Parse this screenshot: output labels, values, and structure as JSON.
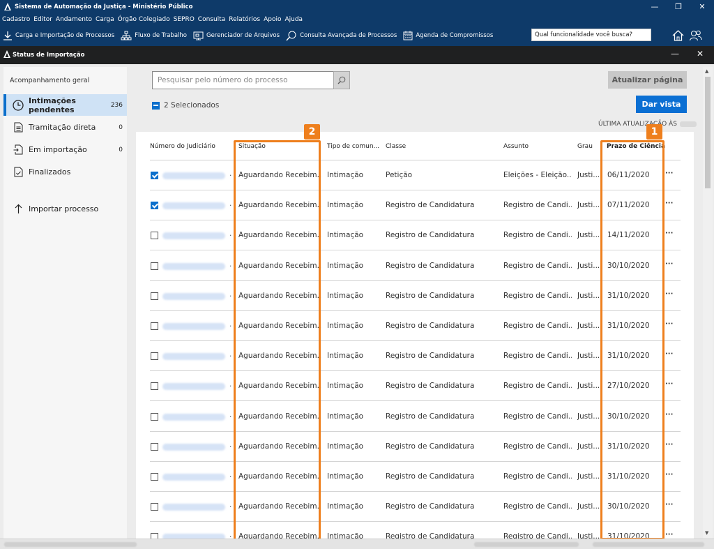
{
  "window": {
    "title": "Sistema de Automação da Justiça - Ministério Público",
    "minimize": "—",
    "maximize": "❐",
    "close": "✕"
  },
  "menu": [
    "Cadastro",
    "Editor",
    "Andamento",
    "Carga",
    "Órgão Colegiado",
    "SEPRO",
    "Consulta",
    "Relatórios",
    "Apoio",
    "Ajuda"
  ],
  "toolbar": {
    "items": [
      {
        "label": "Carga e Importação de Processos",
        "icon": "download-icon"
      },
      {
        "label": "Fluxo de Trabalho",
        "icon": "workflow-icon"
      },
      {
        "label": "Gerenciador de Arquivos",
        "icon": "file-manager-icon"
      },
      {
        "label": "Consulta Avançada de Processos",
        "icon": "chat-search-icon"
      },
      {
        "label": "Agenda de Compromissos",
        "icon": "calendar-icon"
      }
    ],
    "search_placeholder": "Qual funcionalidade você busca?"
  },
  "subwindow": {
    "title": "Status de Importação"
  },
  "sidebar": {
    "heading": "Acompanhamento geral",
    "items": [
      {
        "label": "Intimações pendentes",
        "count": "236",
        "icon": "clock-icon",
        "active": true
      },
      {
        "label": "Tramitação direta",
        "count": "0",
        "icon": "document-icon",
        "active": false
      },
      {
        "label": "Em importação",
        "count": "0",
        "icon": "document-import-icon",
        "active": false
      },
      {
        "label": "Finalizados",
        "count": "",
        "icon": "document-done-icon",
        "active": false
      }
    ],
    "import_label": "Importar processo"
  },
  "main": {
    "search_placeholder": "Pesquisar pelo número do processo",
    "refresh_label": "Atualizar página",
    "vista_label": "Dar vista",
    "selected_label": "2 Selecionados",
    "last_update_label": "ÚLTIMA ATUALIZAÇÃO ÀS",
    "columns": [
      "Número do Judiciário",
      "Situação",
      "Tipo de comun...",
      "Classe",
      "Assunto",
      "Grau",
      "Prazo de Ciência"
    ],
    "rows": [
      {
        "checked": true,
        "situacao": "Aguardando Recebim...",
        "tipo": "Intimação",
        "classe": "Petição",
        "assunto": "Eleições - Eleição...",
        "grau": "Justi...",
        "prazo": "06/11/2020"
      },
      {
        "checked": true,
        "situacao": "Aguardando Recebim...",
        "tipo": "Intimação",
        "classe": "Registro de Candidatura",
        "assunto": "Registro de Candi...",
        "grau": "Justi...",
        "prazo": "07/11/2020"
      },
      {
        "checked": false,
        "situacao": "Aguardando Recebim...",
        "tipo": "Intimação",
        "classe": "Registro de Candidatura",
        "assunto": "Registro de Candi...",
        "grau": "Justi...",
        "prazo": "14/11/2020"
      },
      {
        "checked": false,
        "situacao": "Aguardando Recebim...",
        "tipo": "Intimação",
        "classe": "Registro de Candidatura",
        "assunto": "Registro de Candi...",
        "grau": "Justi...",
        "prazo": "30/10/2020"
      },
      {
        "checked": false,
        "situacao": "Aguardando Recebim...",
        "tipo": "Intimação",
        "classe": "Registro de Candidatura",
        "assunto": "Registro de Candi...",
        "grau": "Justi...",
        "prazo": "31/10/2020"
      },
      {
        "checked": false,
        "situacao": "Aguardando Recebim...",
        "tipo": "Intimação",
        "classe": "Registro de Candidatura",
        "assunto": "Registro de Candi...",
        "grau": "Justi...",
        "prazo": "31/10/2020"
      },
      {
        "checked": false,
        "situacao": "Aguardando Recebim...",
        "tipo": "Intimação",
        "classe": "Registro de Candidatura",
        "assunto": "Registro de Candi...",
        "grau": "Justi...",
        "prazo": "31/10/2020"
      },
      {
        "checked": false,
        "situacao": "Aguardando Recebim...",
        "tipo": "Intimação",
        "classe": "Registro de Candidatura",
        "assunto": "Registro de Candi...",
        "grau": "Justi...",
        "prazo": "27/10/2020"
      },
      {
        "checked": false,
        "situacao": "Aguardando Recebim...",
        "tipo": "Intimação",
        "classe": "Registro de Candidatura",
        "assunto": "Registro de Candi...",
        "grau": "Justi...",
        "prazo": "30/10/2020"
      },
      {
        "checked": false,
        "situacao": "Aguardando Recebim...",
        "tipo": "Intimação",
        "classe": "Registro de Candidatura",
        "assunto": "Registro de Candi...",
        "grau": "Justi...",
        "prazo": "31/10/2020"
      },
      {
        "checked": false,
        "situacao": "Aguardando Recebim...",
        "tipo": "Intimação",
        "classe": "Registro de Candidatura",
        "assunto": "Registro de Candi...",
        "grau": "Justi...",
        "prazo": "31/10/2020"
      },
      {
        "checked": false,
        "situacao": "Aguardando Recebim...",
        "tipo": "Intimação",
        "classe": "Registro de Candidatura",
        "assunto": "Registro de Candi...",
        "grau": "Justi...",
        "prazo": "30/10/2020"
      },
      {
        "checked": false,
        "situacao": "Aguardando Recebim...",
        "tipo": "Intimação",
        "classe": "Registro de Candidatura",
        "assunto": "Registro de Candi...",
        "grau": "Justi...",
        "prazo": "31/10/2020"
      }
    ],
    "more_label": "···"
  },
  "annotations": {
    "badge_1": "1",
    "badge_2": "2"
  },
  "colors": {
    "header": "#0e3a69",
    "accent": "#0b6fcc",
    "highlight": "#ee7f1d"
  }
}
